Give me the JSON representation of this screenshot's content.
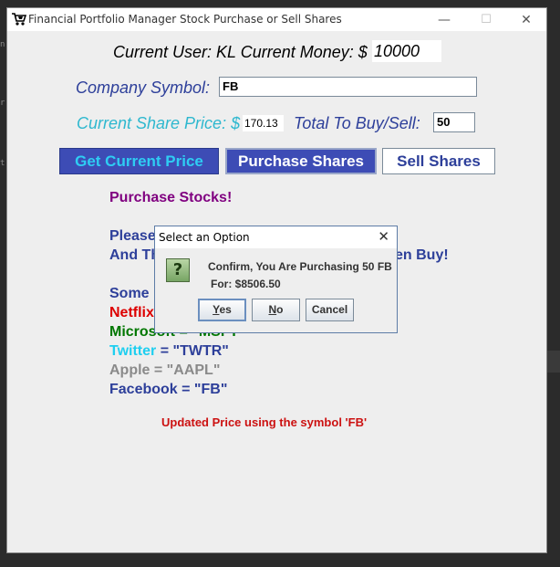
{
  "window": {
    "title": "Financial Portfolio Manager Stock Purchase or Sell Shares",
    "minimize_glyph": "—",
    "maximize_glyph": "☐",
    "close_glyph": "✕"
  },
  "user_row": {
    "text": "Current User: KL Current Money: $",
    "money_value": "10000"
  },
  "symbol_row": {
    "label": "Company Symbol:",
    "value": "FB"
  },
  "price_row": {
    "label": "Current Share Price: $",
    "price_value": "170.13",
    "total_label": "Total To Buy/Sell:",
    "total_value": "50"
  },
  "buttons": {
    "get_price": "Get Current Price",
    "purchase": "Purchase Shares",
    "sell": "Sell Shares"
  },
  "info": {
    "heading": "Purchase Stocks!",
    "line1": "Please",
    "line2_start": "And Th",
    "line2_end": "en Buy!",
    "line3": "Some I",
    "netflix": "Netflix",
    "microsoft_partial": "Microsoft = \"MSFT\"",
    "twitter_name": "Twitter",
    "twitter_code": " = \"TWTR\"",
    "apple": "Apple = \"AAPL\"",
    "facebook": "Facebook = \"FB\"",
    "status": "Updated Price using the symbol 'FB'"
  },
  "dialog": {
    "title": "Select an Option",
    "close_glyph": "✕",
    "message_line1": "Confirm, You Are Purchasing 50 FB",
    "message_line2": "For: $8506.50",
    "icon_glyph": "?",
    "yes_first": "Y",
    "yes_rest": "es",
    "no_first": "N",
    "no_rest": "o",
    "cancel": "Cancel"
  },
  "colors": {
    "navy": "#2d3f9a",
    "purple": "#800080",
    "red": "#dd0000",
    "green": "#007700",
    "cyan": "#1ecff0",
    "gray": "#8a8a8a",
    "price_cyan": "#2eb8cf",
    "status_red": "#cc1111"
  }
}
